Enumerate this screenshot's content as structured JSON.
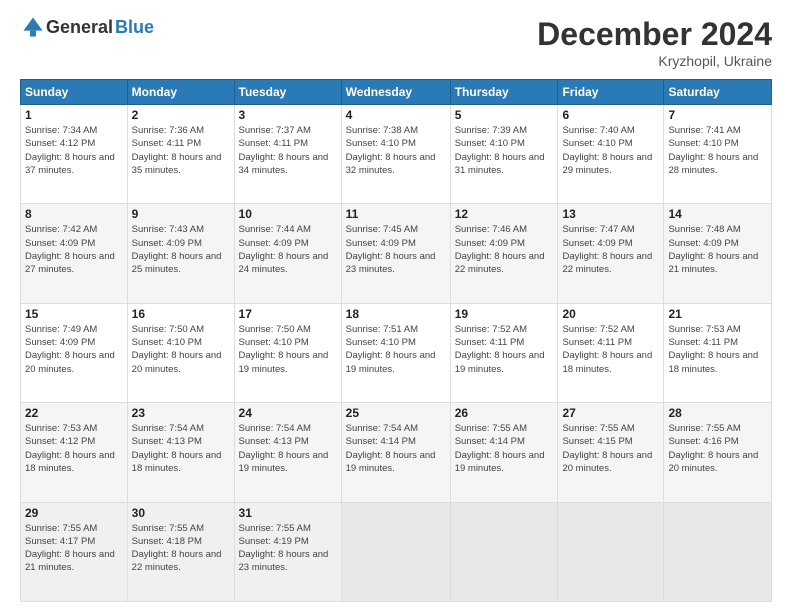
{
  "header": {
    "logo_general": "General",
    "logo_blue": "Blue",
    "title": "December 2024",
    "location": "Kryzhopil, Ukraine"
  },
  "days_of_week": [
    "Sunday",
    "Monday",
    "Tuesday",
    "Wednesday",
    "Thursday",
    "Friday",
    "Saturday"
  ],
  "weeks": [
    [
      {
        "day": "1",
        "sunrise": "7:34 AM",
        "sunset": "4:12 PM",
        "daylight": "8 hours and 37 minutes."
      },
      {
        "day": "2",
        "sunrise": "7:36 AM",
        "sunset": "4:11 PM",
        "daylight": "8 hours and 35 minutes."
      },
      {
        "day": "3",
        "sunrise": "7:37 AM",
        "sunset": "4:11 PM",
        "daylight": "8 hours and 34 minutes."
      },
      {
        "day": "4",
        "sunrise": "7:38 AM",
        "sunset": "4:10 PM",
        "daylight": "8 hours and 32 minutes."
      },
      {
        "day": "5",
        "sunrise": "7:39 AM",
        "sunset": "4:10 PM",
        "daylight": "8 hours and 31 minutes."
      },
      {
        "day": "6",
        "sunrise": "7:40 AM",
        "sunset": "4:10 PM",
        "daylight": "8 hours and 29 minutes."
      },
      {
        "day": "7",
        "sunrise": "7:41 AM",
        "sunset": "4:10 PM",
        "daylight": "8 hours and 28 minutes."
      }
    ],
    [
      {
        "day": "8",
        "sunrise": "7:42 AM",
        "sunset": "4:09 PM",
        "daylight": "8 hours and 27 minutes."
      },
      {
        "day": "9",
        "sunrise": "7:43 AM",
        "sunset": "4:09 PM",
        "daylight": "8 hours and 25 minutes."
      },
      {
        "day": "10",
        "sunrise": "7:44 AM",
        "sunset": "4:09 PM",
        "daylight": "8 hours and 24 minutes."
      },
      {
        "day": "11",
        "sunrise": "7:45 AM",
        "sunset": "4:09 PM",
        "daylight": "8 hours and 23 minutes."
      },
      {
        "day": "12",
        "sunrise": "7:46 AM",
        "sunset": "4:09 PM",
        "daylight": "8 hours and 22 minutes."
      },
      {
        "day": "13",
        "sunrise": "7:47 AM",
        "sunset": "4:09 PM",
        "daylight": "8 hours and 22 minutes."
      },
      {
        "day": "14",
        "sunrise": "7:48 AM",
        "sunset": "4:09 PM",
        "daylight": "8 hours and 21 minutes."
      }
    ],
    [
      {
        "day": "15",
        "sunrise": "7:49 AM",
        "sunset": "4:09 PM",
        "daylight": "8 hours and 20 minutes."
      },
      {
        "day": "16",
        "sunrise": "7:50 AM",
        "sunset": "4:10 PM",
        "daylight": "8 hours and 20 minutes."
      },
      {
        "day": "17",
        "sunrise": "7:50 AM",
        "sunset": "4:10 PM",
        "daylight": "8 hours and 19 minutes."
      },
      {
        "day": "18",
        "sunrise": "7:51 AM",
        "sunset": "4:10 PM",
        "daylight": "8 hours and 19 minutes."
      },
      {
        "day": "19",
        "sunrise": "7:52 AM",
        "sunset": "4:11 PM",
        "daylight": "8 hours and 19 minutes."
      },
      {
        "day": "20",
        "sunrise": "7:52 AM",
        "sunset": "4:11 PM",
        "daylight": "8 hours and 18 minutes."
      },
      {
        "day": "21",
        "sunrise": "7:53 AM",
        "sunset": "4:11 PM",
        "daylight": "8 hours and 18 minutes."
      }
    ],
    [
      {
        "day": "22",
        "sunrise": "7:53 AM",
        "sunset": "4:12 PM",
        "daylight": "8 hours and 18 minutes."
      },
      {
        "day": "23",
        "sunrise": "7:54 AM",
        "sunset": "4:13 PM",
        "daylight": "8 hours and 18 minutes."
      },
      {
        "day": "24",
        "sunrise": "7:54 AM",
        "sunset": "4:13 PM",
        "daylight": "8 hours and 19 minutes."
      },
      {
        "day": "25",
        "sunrise": "7:54 AM",
        "sunset": "4:14 PM",
        "daylight": "8 hours and 19 minutes."
      },
      {
        "day": "26",
        "sunrise": "7:55 AM",
        "sunset": "4:14 PM",
        "daylight": "8 hours and 19 minutes."
      },
      {
        "day": "27",
        "sunrise": "7:55 AM",
        "sunset": "4:15 PM",
        "daylight": "8 hours and 20 minutes."
      },
      {
        "day": "28",
        "sunrise": "7:55 AM",
        "sunset": "4:16 PM",
        "daylight": "8 hours and 20 minutes."
      }
    ],
    [
      {
        "day": "29",
        "sunrise": "7:55 AM",
        "sunset": "4:17 PM",
        "daylight": "8 hours and 21 minutes."
      },
      {
        "day": "30",
        "sunrise": "7:55 AM",
        "sunset": "4:18 PM",
        "daylight": "8 hours and 22 minutes."
      },
      {
        "day": "31",
        "sunrise": "7:55 AM",
        "sunset": "4:19 PM",
        "daylight": "8 hours and 23 minutes."
      },
      null,
      null,
      null,
      null
    ]
  ],
  "labels": {
    "sunrise": "Sunrise:",
    "sunset": "Sunset:",
    "daylight": "Daylight:"
  }
}
